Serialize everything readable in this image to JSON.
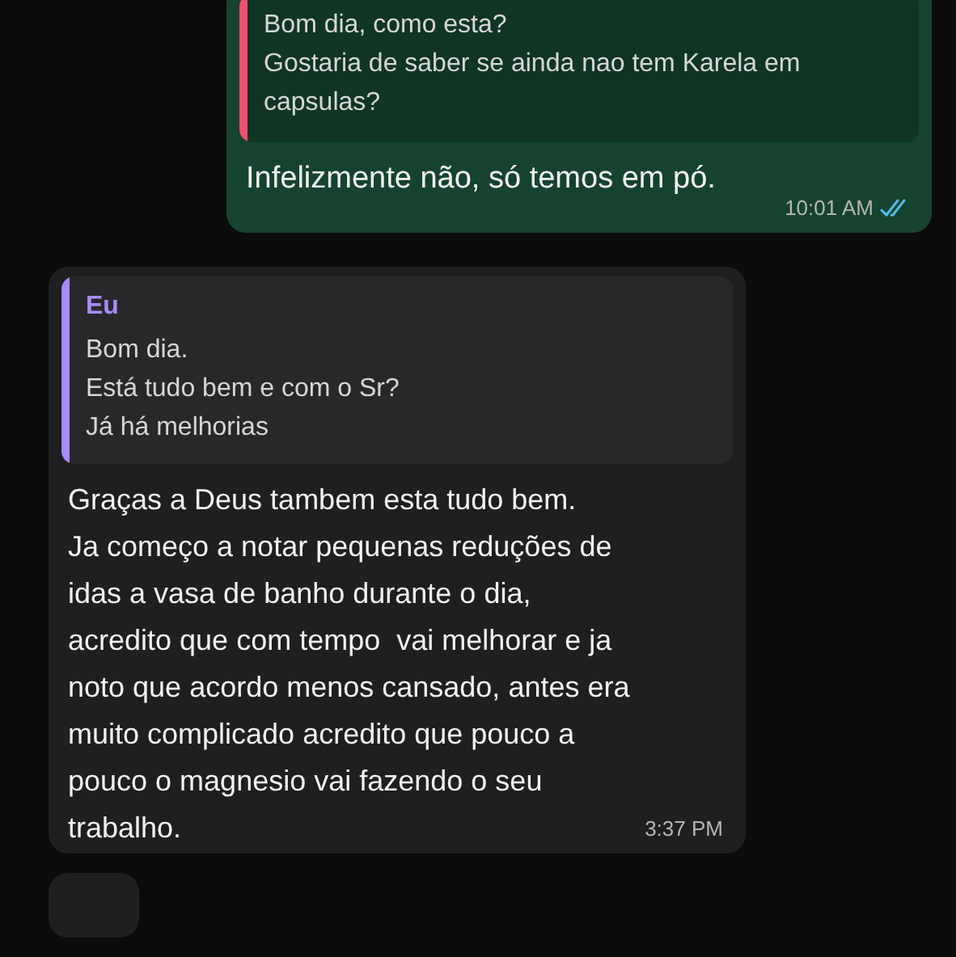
{
  "messages": [
    {
      "kind": "outgoing",
      "quote": {
        "text": "Bom dia, como esta?\nGostaria de saber se ainda nao tem Karela em capsulas?",
        "color": "#f0506e"
      },
      "text": "Infelizmente não, só temos em pó.",
      "time": "10:01 AM",
      "read": true
    },
    {
      "kind": "incoming",
      "quote": {
        "author": "Eu",
        "text": "Bom dia.\nEstá tudo bem e com o Sr?\nJá há melhorias",
        "color": "#a78bfa"
      },
      "text": "Graças a Deus tambem esta tudo bem.\nJa começo a notar pequenas reduções de idas a vasa de banho durante o dia, acredito que com tempo  vai melhorar e ja noto que acordo menos cansado, antes era muito complicado acredito que pouco a pouco o magnesio vai fazendo o seu trabalho.",
      "time": "3:37 PM"
    },
    {
      "kind": "incoming-cut"
    }
  ]
}
